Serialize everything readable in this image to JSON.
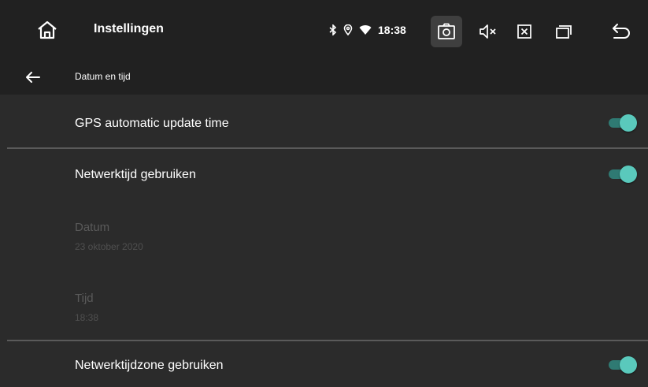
{
  "header": {
    "title": "Instellingen",
    "time": "18:38",
    "icons": [
      "home-icon",
      "bluetooth-icon",
      "location-icon",
      "wifi-icon",
      "screenshot-icon",
      "mute-icon",
      "close-app-icon",
      "recent-apps-icon",
      "return-icon"
    ]
  },
  "subheader": {
    "label": "Datum en tijd"
  },
  "settings": [
    {
      "label": "GPS automatic update time",
      "toggle": true
    },
    {
      "label": "Netwerktijd gebruiken",
      "toggle": true
    },
    {
      "label": "Datum",
      "value": "23 oktober 2020",
      "disabled": true
    },
    {
      "label": "Tijd",
      "value": "18:38",
      "disabled": true
    },
    {
      "label": "Netwerktijdzone gebruiken",
      "toggle": true
    }
  ],
  "colors": {
    "accent": "#5ac9bc",
    "background": "#2b2b2b",
    "bar": "#212121",
    "disabled_text": "#5a5a5a"
  }
}
